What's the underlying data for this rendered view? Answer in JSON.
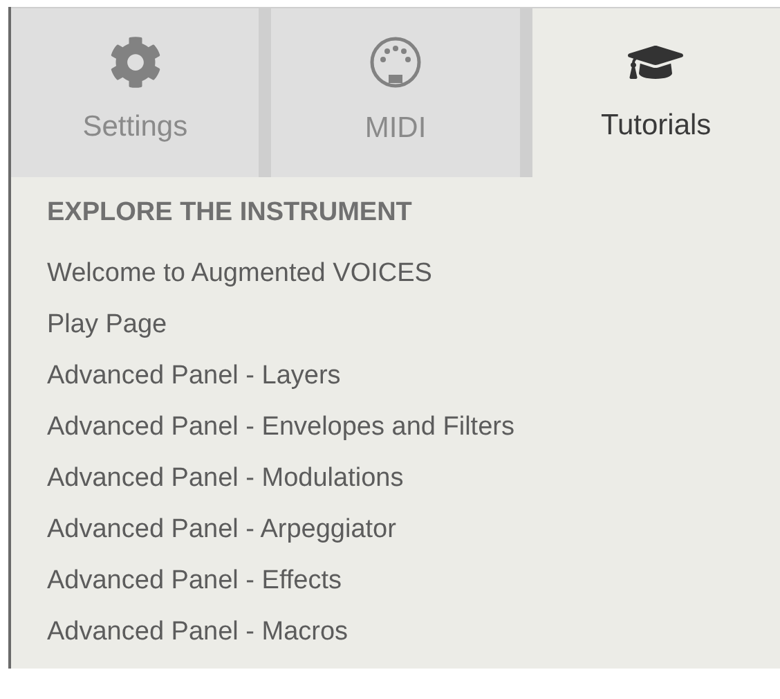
{
  "tabs": [
    {
      "label": "Settings",
      "kind": "gear",
      "selected": false
    },
    {
      "label": "MIDI",
      "kind": "midi",
      "selected": false
    },
    {
      "label": "Tutorials",
      "kind": "cap",
      "selected": true
    }
  ],
  "section": {
    "heading": "EXPLORE THE INSTRUMENT",
    "items": [
      "Welcome to Augmented VOICES",
      "Play Page",
      "Advanced Panel - Layers",
      "Advanced Panel - Envelopes and Filters",
      "Advanced Panel - Modulations",
      "Advanced Panel - Arpeggiator",
      "Advanced Panel - Effects",
      "Advanced Panel - Macros"
    ]
  }
}
